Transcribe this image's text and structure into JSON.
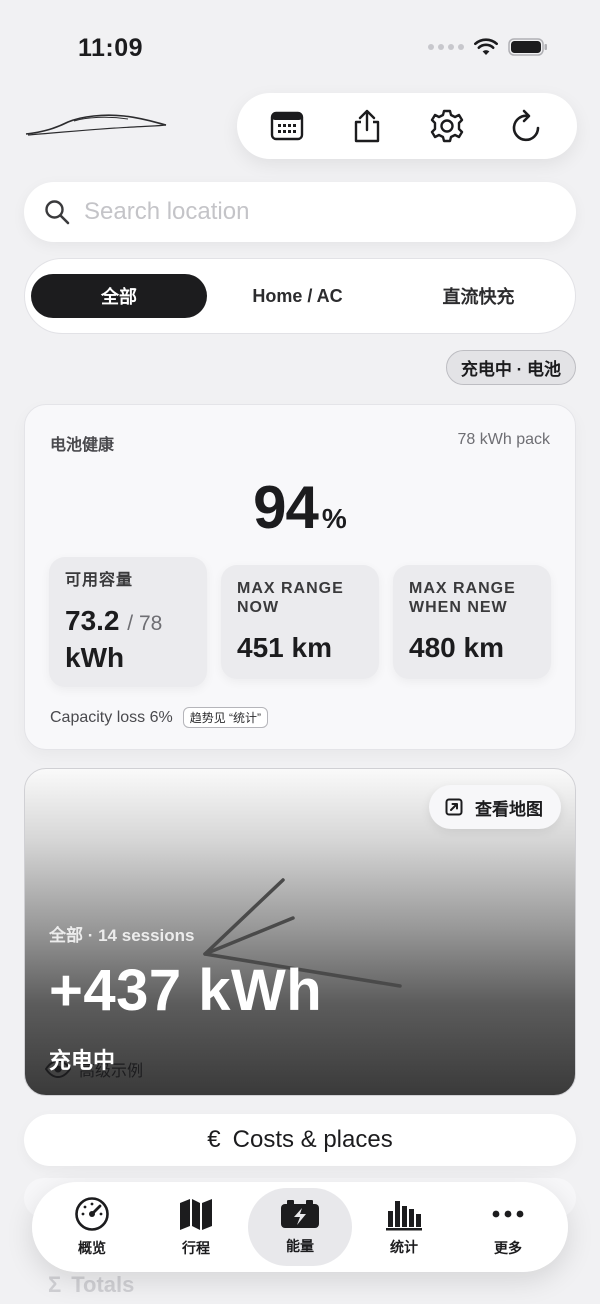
{
  "status_bar": {
    "time": "11:09"
  },
  "header": {
    "toolbar": [
      {
        "icon": "calendar-icon"
      },
      {
        "icon": "share-icon"
      },
      {
        "icon": "gear-icon"
      },
      {
        "icon": "refresh-icon"
      }
    ]
  },
  "search": {
    "placeholder": "Search location",
    "value": ""
  },
  "segments": [
    {
      "label": "全部",
      "active": true
    },
    {
      "label": "Home / AC",
      "active": false
    },
    {
      "label": "直流快充",
      "active": false
    }
  ],
  "status_chip": "充电中 · 电池",
  "battery": {
    "title": "电池健康",
    "pack": "78 kWh pack",
    "health_value": "94",
    "health_unit": "%",
    "capacity_label": "可用容量",
    "capacity_value": "73.2",
    "capacity_total": "/ 78",
    "capacity_unit": "kWh",
    "max_now_label_1": "MAX RANGE",
    "max_now_label_2": "NOW",
    "max_now_value": "451 km",
    "max_new_label_1": "MAX RANGE",
    "max_new_label_2": "WHEN NEW",
    "max_new_value": "480 km",
    "capacity_loss": "Capacity loss 6%",
    "trend_chip": "趋势见 “统计”"
  },
  "charging": {
    "map_button": "查看地图",
    "sessions": "全部 · 14 sessions",
    "energy": "+437 kWh",
    "status": "充电中",
    "demo_label": "高级示例"
  },
  "costs": {
    "label": "Costs & places",
    "currency": "€"
  },
  "totals": {
    "label": "Totals",
    "symbol": "Σ"
  },
  "tabbar": [
    {
      "label": "概览",
      "icon": "speedometer-icon",
      "active": false
    },
    {
      "label": "行程",
      "icon": "map-icon",
      "active": false
    },
    {
      "label": "能量",
      "icon": "battery-charge-icon",
      "active": true
    },
    {
      "label": "统计",
      "icon": "bar-chart-icon",
      "active": false
    },
    {
      "label": "更多",
      "icon": "more-icon",
      "active": false
    }
  ]
}
